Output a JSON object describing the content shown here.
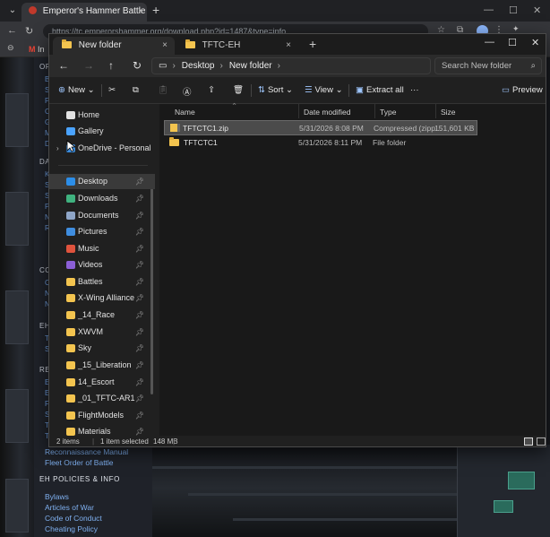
{
  "browser": {
    "tab_title": "Emperor's Hammer Battle Center",
    "tab_close": "×",
    "new_tab": "+",
    "url": "https://tc.emperorshammer.org/download.php?id=1487&type=info",
    "bookmark_gmail": "In"
  },
  "site": {
    "sections": [
      {
        "label": "OP",
        "letters": [
          "B",
          "S",
          "P",
          "C",
          "G",
          "M",
          "D"
        ]
      },
      {
        "label": "DA",
        "letters": [
          "K",
          "S",
          "S",
          "P",
          "N",
          "R"
        ]
      },
      {
        "label": "CO",
        "letters": [
          "C",
          "N",
          "N"
        ]
      },
      {
        "label": "EH",
        "letters": [
          "T",
          "S"
        ]
      },
      {
        "label": "RE",
        "letters": [
          "E",
          "E",
          "F",
          "S",
          "T",
          "T"
        ]
      }
    ],
    "links": [
      "Reconnaissance Manual",
      "Fleet Order of Battle"
    ],
    "policies_heading": "EH POLICIES & INFO",
    "policies": [
      "Bylaws",
      "Articles of War",
      "Code of Conduct",
      "Cheating Policy"
    ]
  },
  "explorer": {
    "tabs": [
      {
        "label": "New folder",
        "close": "×"
      },
      {
        "label": "TFTC-EH",
        "close": "×"
      }
    ],
    "new_tab": "+",
    "path": [
      "Desktop",
      "New folder"
    ],
    "path_sep": "›",
    "search_placeholder": "Search New folder",
    "toolbar": {
      "new": "New",
      "sort": "Sort",
      "view": "View",
      "extract_all": "Extract all",
      "more": "···",
      "preview": "Preview"
    },
    "nav_pane": [
      {
        "label": "Home",
        "icon": "home-icon",
        "color": "#e2e2e2",
        "pinned": false
      },
      {
        "label": "Gallery",
        "icon": "gallery-icon",
        "color": "#4aa3ff",
        "pinned": false
      },
      {
        "label": "OneDrive - Personal",
        "icon": "onedrive-icon",
        "color": "#3b8bdb",
        "pinned": false
      },
      {
        "label": "Desktop",
        "icon": "desktop-icon",
        "color": "#2c8ee8",
        "pinned": true
      },
      {
        "label": "Downloads",
        "icon": "downloads-icon",
        "color": "#3fb27f",
        "pinned": true
      },
      {
        "label": "Documents",
        "icon": "documents-icon",
        "color": "#8fa6c8",
        "pinned": true
      },
      {
        "label": "Pictures",
        "icon": "pictures-icon",
        "color": "#3f8ddf",
        "pinned": true
      },
      {
        "label": "Music",
        "icon": "music-icon",
        "color": "#e0533d",
        "pinned": true
      },
      {
        "label": "Videos",
        "icon": "videos-icon",
        "color": "#8b5fd6",
        "pinned": true
      },
      {
        "label": "Battles",
        "icon": "folder-icon",
        "color": "#f3c44f",
        "pinned": true
      },
      {
        "label": "X-Wing Alliance",
        "icon": "folder-icon",
        "color": "#f3c44f",
        "pinned": true
      },
      {
        "label": "_14_Race",
        "icon": "folder-icon",
        "color": "#f3c44f",
        "pinned": true
      },
      {
        "label": "XWVM",
        "icon": "folder-icon",
        "color": "#f3c44f",
        "pinned": true
      },
      {
        "label": "Sky",
        "icon": "folder-icon",
        "color": "#f3c44f",
        "pinned": true
      },
      {
        "label": "_15_Liberation",
        "icon": "folder-icon",
        "color": "#f3c44f",
        "pinned": true
      },
      {
        "label": "14_Escort",
        "icon": "folder-icon",
        "color": "#f3c44f",
        "pinned": true
      },
      {
        "label": "_01_TFTC-AR1",
        "icon": "folder-icon",
        "color": "#f3c44f",
        "pinned": true
      },
      {
        "label": "FlightModels",
        "icon": "folder-icon",
        "color": "#f3c44f",
        "pinned": true
      },
      {
        "label": "Materials",
        "icon": "folder-icon",
        "color": "#f3c44f",
        "pinned": true
      }
    ],
    "columns": [
      "Name",
      "Date modified",
      "Type",
      "Size"
    ],
    "files": [
      {
        "name": "TFTCTC1.zip",
        "date": "5/31/2026 8:08 PM",
        "type": "Compressed (zipp...",
        "size": "151,601 KB",
        "kind": "zip",
        "selected": true
      },
      {
        "name": "TFTCTC1",
        "date": "5/31/2026 8:11 PM",
        "type": "File folder",
        "size": "",
        "kind": "folder",
        "selected": false
      }
    ],
    "status": {
      "items": "2 items",
      "selected": "1 item selected",
      "size": "148 MB"
    }
  }
}
